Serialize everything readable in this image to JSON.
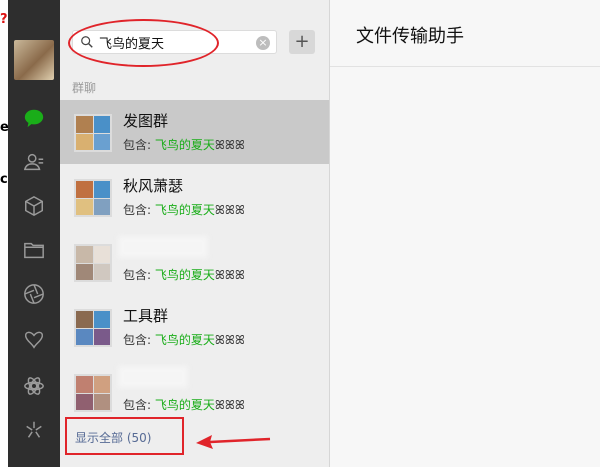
{
  "sidebar": {
    "icons": [
      "chat-icon",
      "contacts-icon",
      "favorites-cube-icon",
      "folder-icon",
      "moments-aperture-icon",
      "butterfly-icon",
      "plugin-icon",
      "sparkle-icon"
    ],
    "edge_glyphs": [
      "?",
      "e",
      "c"
    ]
  },
  "search": {
    "value": "飞鸟的夏天",
    "clear": "×",
    "add": "+"
  },
  "list": {
    "section_label": "群聊",
    "items": [
      {
        "name": "发图群",
        "contains_prefix": "包含: ",
        "highlight": "飞鸟的夏天",
        "suffix": "ꕤꕤꕤ"
      },
      {
        "name": "秋风萧瑟",
        "contains_prefix": "包含: ",
        "highlight": "飞鸟的夏天",
        "suffix": "ꕤꕤꕤ"
      },
      {
        "name": "",
        "contains_prefix": "包含: ",
        "highlight": "飞鸟的夏天",
        "suffix": "ꕤꕤꕤ"
      },
      {
        "name": "工具群",
        "contains_prefix": "包含: ",
        "highlight": "飞鸟的夏天",
        "suffix": "ꕤꕤꕤ"
      },
      {
        "name": "",
        "contains_prefix": "包含: ",
        "highlight": "飞鸟的夏天",
        "suffix": "ꕤꕤꕤ"
      }
    ],
    "show_all": "显示全部 (50)"
  },
  "main": {
    "title": "文件传输助手"
  },
  "colors": {
    "rail": "#2e2e2e",
    "list_bg": "#eeeeee",
    "selected": "#c9c9c9",
    "highlight": "#1aad19",
    "annotation": "#e0242a",
    "link": "#576b95"
  }
}
